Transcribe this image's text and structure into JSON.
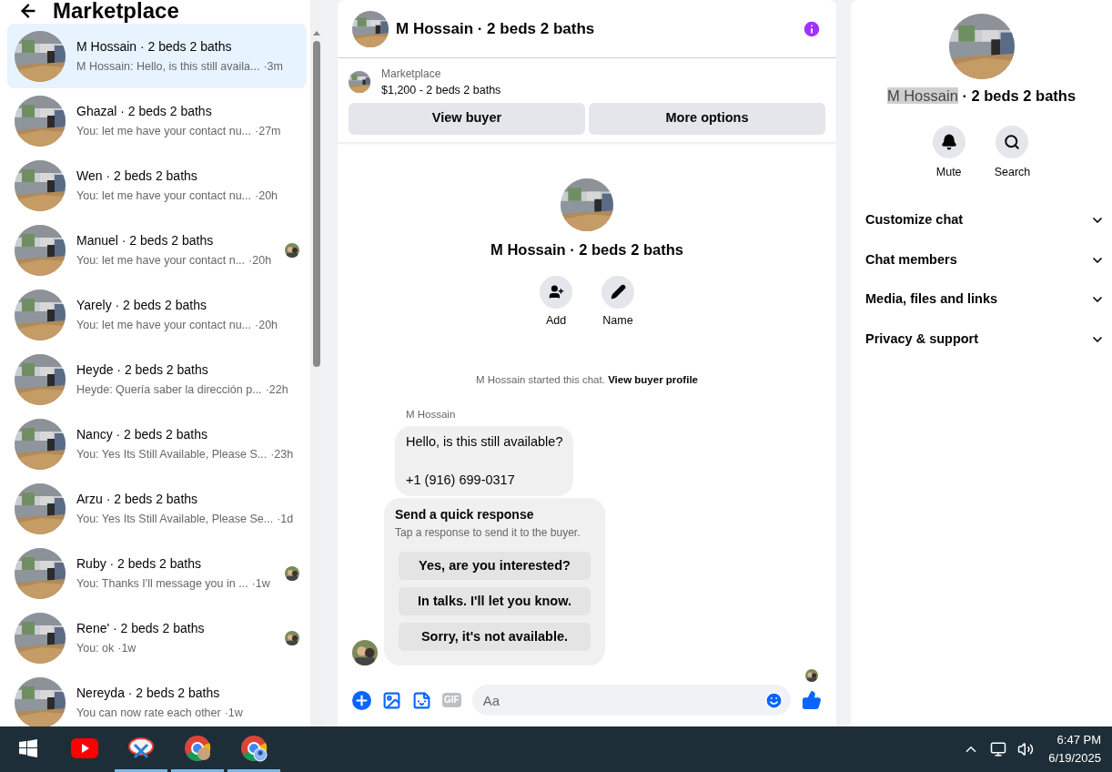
{
  "sidebar": {
    "title": "Marketplace",
    "conversations": [
      {
        "name": "M Hossain · 2 beds 2 baths",
        "preview": "M Hossain: Hello, is this still availa...",
        "time": "·3m",
        "selected": true,
        "seen_avatar": false
      },
      {
        "name": "Ghazal · 2 beds 2 baths",
        "preview": "You: let me have your contact nu...",
        "time": "·27m",
        "selected": false,
        "seen_avatar": false
      },
      {
        "name": "Wen · 2 beds 2 baths",
        "preview": "You: let me have your contact nu...",
        "time": "·20h",
        "selected": false,
        "seen_avatar": false
      },
      {
        "name": "Manuel · 2 beds 2 baths",
        "preview": "You: let me have your contact n...",
        "time": "·20h",
        "selected": false,
        "seen_avatar": true
      },
      {
        "name": "Yarely · 2 beds 2 baths",
        "preview": "You: let me have your contact nu...",
        "time": "·20h",
        "selected": false,
        "seen_avatar": false
      },
      {
        "name": "Heyde · 2 beds 2 baths",
        "preview": "Heyde: Quería saber la dirección p...",
        "time": "·22h",
        "selected": false,
        "seen_avatar": false
      },
      {
        "name": "Nancy · 2 beds 2 baths",
        "preview": "You: Yes Its Still Available, Please S...",
        "time": "·23h",
        "selected": false,
        "seen_avatar": false
      },
      {
        "name": "Arzu · 2 beds 2 baths",
        "preview": "You: Yes Its Still Available, Please Se...",
        "time": "·1d",
        "selected": false,
        "seen_avatar": false
      },
      {
        "name": "Ruby · 2 beds 2 baths",
        "preview": "You: Thanks I'll message you in ...",
        "time": "·1w",
        "selected": false,
        "seen_avatar": true
      },
      {
        "name": "Rene' · 2 beds 2 baths",
        "preview": "You: ok",
        "time": "·1w",
        "selected": false,
        "seen_avatar": true
      },
      {
        "name": "Nereyda · 2 beds 2 baths",
        "preview": "You can now rate each other",
        "time": "·1w",
        "selected": false,
        "seen_avatar": false
      }
    ]
  },
  "chat": {
    "title": "M Hossain · 2 beds 2 baths",
    "listing": {
      "source": "Marketplace",
      "summary": "$1,200 - 2 beds 2 baths",
      "buttons": [
        "View buyer",
        "More options"
      ]
    },
    "intro": {
      "title": "M Hossain · 2 beds 2 baths",
      "actions": [
        {
          "kind": "add",
          "label": "Add"
        },
        {
          "kind": "name",
          "label": "Name"
        }
      ],
      "notice": "M Hossain started this chat.",
      "notice_link": "View buyer profile"
    },
    "sender": "M Hossain",
    "message": [
      "Hello, is this still available?",
      "+1 (916) 699-0317"
    ],
    "quick": {
      "title": "Send a quick response",
      "subtitle": "Tap a response to send it to the buyer.",
      "options": [
        "Yes, are you interested?",
        "In talks. I'll let you know.",
        "Sorry, it's not available."
      ]
    },
    "composer": {
      "gif": "GIF",
      "placeholder": "Aa"
    }
  },
  "details": {
    "title_highlighted": "M Hossain",
    "title_rest": " · 2 beds 2 baths",
    "actions": [
      {
        "kind": "mute",
        "label": "Mute"
      },
      {
        "kind": "search",
        "label": "Search"
      }
    ],
    "sections": [
      {
        "label": "Customize chat",
        "expanded": false
      },
      {
        "label": "Chat members",
        "expanded": false
      },
      {
        "label": "Media, files and links",
        "expanded": false
      },
      {
        "label": "Privacy & support",
        "expanded": false
      }
    ]
  },
  "taskbar": {
    "apps": [
      {
        "kind": "windows",
        "running": false
      },
      {
        "kind": "youtube",
        "running": false
      },
      {
        "kind": "snip",
        "running": true
      },
      {
        "kind": "chrome",
        "running": true
      },
      {
        "kind": "chrome-profile",
        "running": true
      }
    ],
    "time": "6:47 PM",
    "date": "6/19/2025"
  }
}
